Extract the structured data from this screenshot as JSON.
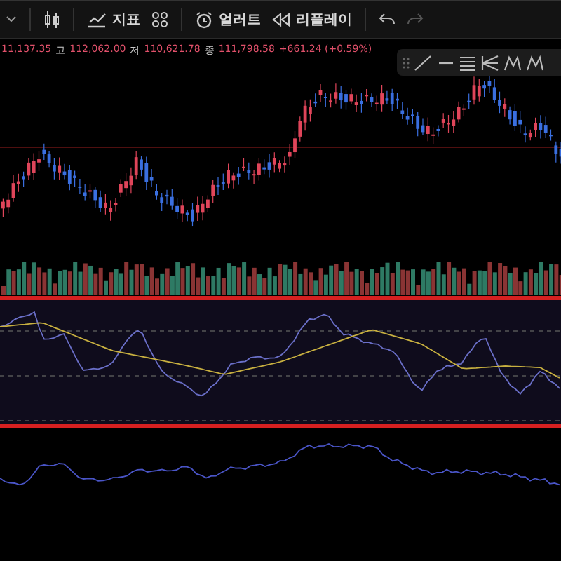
{
  "toolbar": {
    "items": [
      {
        "kind": "indicators",
        "label": "지표"
      },
      {
        "kind": "alert",
        "label": "얼러트"
      },
      {
        "kind": "replay",
        "label": "리플레이"
      }
    ],
    "undo": {
      "disabled": false
    },
    "redo": {
      "disabled": true
    }
  },
  "legend": {
    "open": "11,137.35",
    "high_label": "고",
    "high": "112,062.00",
    "low_label": "저",
    "low": "110,621.78",
    "close_label": "종",
    "close": "111,798.58",
    "change": "+661.24 (+0.59%)"
  }
}
